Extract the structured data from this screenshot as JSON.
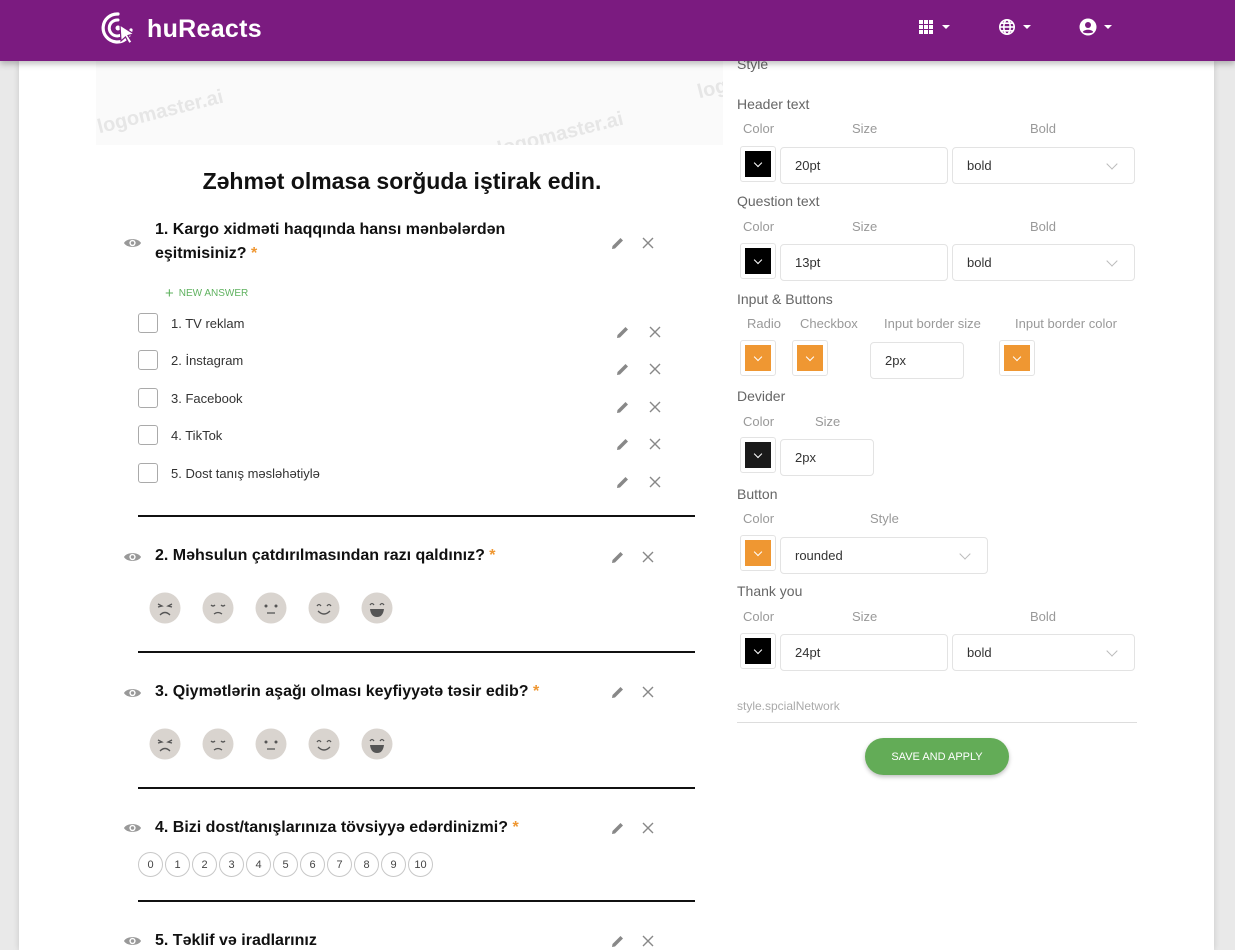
{
  "app": {
    "name": "huReacts",
    "brand_color": "#7b1b80",
    "nav": [
      {
        "icon": "apps-grid-icon"
      },
      {
        "icon": "globe-icon"
      },
      {
        "icon": "account-circle-icon"
      }
    ]
  },
  "banner": {
    "watermark": "logomaster.ai"
  },
  "survey": {
    "title": "Zəhmət olmasa sorğuda iştirak edin.",
    "required_mark": "*",
    "new_answer_label": "NEW ANSWER",
    "questions": [
      {
        "text": "1. Kargo xidməti haqqında hansı mənbələrdən eşitmisiniz?",
        "required": true,
        "type": "checkbox",
        "options": [
          "1. TV reklam",
          "2. İnstagram",
          "3. Facebook",
          "4. TikTok",
          "5. Dost tanış məsləhətiylə"
        ]
      },
      {
        "text": "2. Məhsulun çatdırılmasından razı qaldınız?",
        "required": true,
        "type": "emoji",
        "faces": [
          "angry-face-icon",
          "sad-face-icon",
          "neutral-face-icon",
          "smile-face-icon",
          "laugh-face-icon"
        ]
      },
      {
        "text": "3. Qiymətlərin aşağı olması keyfiyyətə təsir edib?",
        "required": true,
        "type": "emoji",
        "faces": [
          "angry-face-icon",
          "sad-face-icon",
          "neutral-face-icon",
          "smile-face-icon",
          "laugh-face-icon"
        ]
      },
      {
        "text": "4. Bizi dost/tanışlarınıza tövsiyyə edərdinizmi?",
        "required": true,
        "type": "nps",
        "scale": [
          "0",
          "1",
          "2",
          "3",
          "4",
          "5",
          "6",
          "7",
          "8",
          "9",
          "10"
        ]
      },
      {
        "text": "5. Təklif və iradlarınız",
        "required": false,
        "type": "text"
      }
    ]
  },
  "style_panel": {
    "heading": "Style",
    "header_text": {
      "title": "Header text",
      "labels": {
        "color": "Color",
        "size": "Size",
        "bold": "Bold"
      },
      "color": "#000000",
      "size": "20pt",
      "bold": "bold"
    },
    "question_text": {
      "title": "Question text",
      "labels": {
        "color": "Color",
        "size": "Size",
        "bold": "Bold"
      },
      "color": "#000000",
      "size": "13pt",
      "bold": "bold"
    },
    "input_buttons": {
      "title": "Input & Buttons",
      "labels": {
        "radio": "Radio",
        "checkbox": "Checkbox",
        "border_size": "Input border size",
        "border_color": "Input border color"
      },
      "radio_color": "#ef9732",
      "checkbox_color": "#ef9732",
      "border_size": "2px",
      "border_color": "#ef9732"
    },
    "divider": {
      "title": "Devider",
      "labels": {
        "color": "Color",
        "size": "Size"
      },
      "color": "#1a1a1a",
      "size": "2px"
    },
    "button": {
      "title": "Button",
      "labels": {
        "color": "Color",
        "style": "Style"
      },
      "color": "#ef9732",
      "style": "rounded"
    },
    "thank_you": {
      "title": "Thank you",
      "labels": {
        "color": "Color",
        "size": "Size",
        "bold": "Bold"
      },
      "color": "#000000",
      "size": "24pt",
      "bold": "bold"
    },
    "special_network_placeholder": "style.spcialNetwork",
    "save_label": "SAVE AND APPLY",
    "save_color": "#63ac57"
  }
}
